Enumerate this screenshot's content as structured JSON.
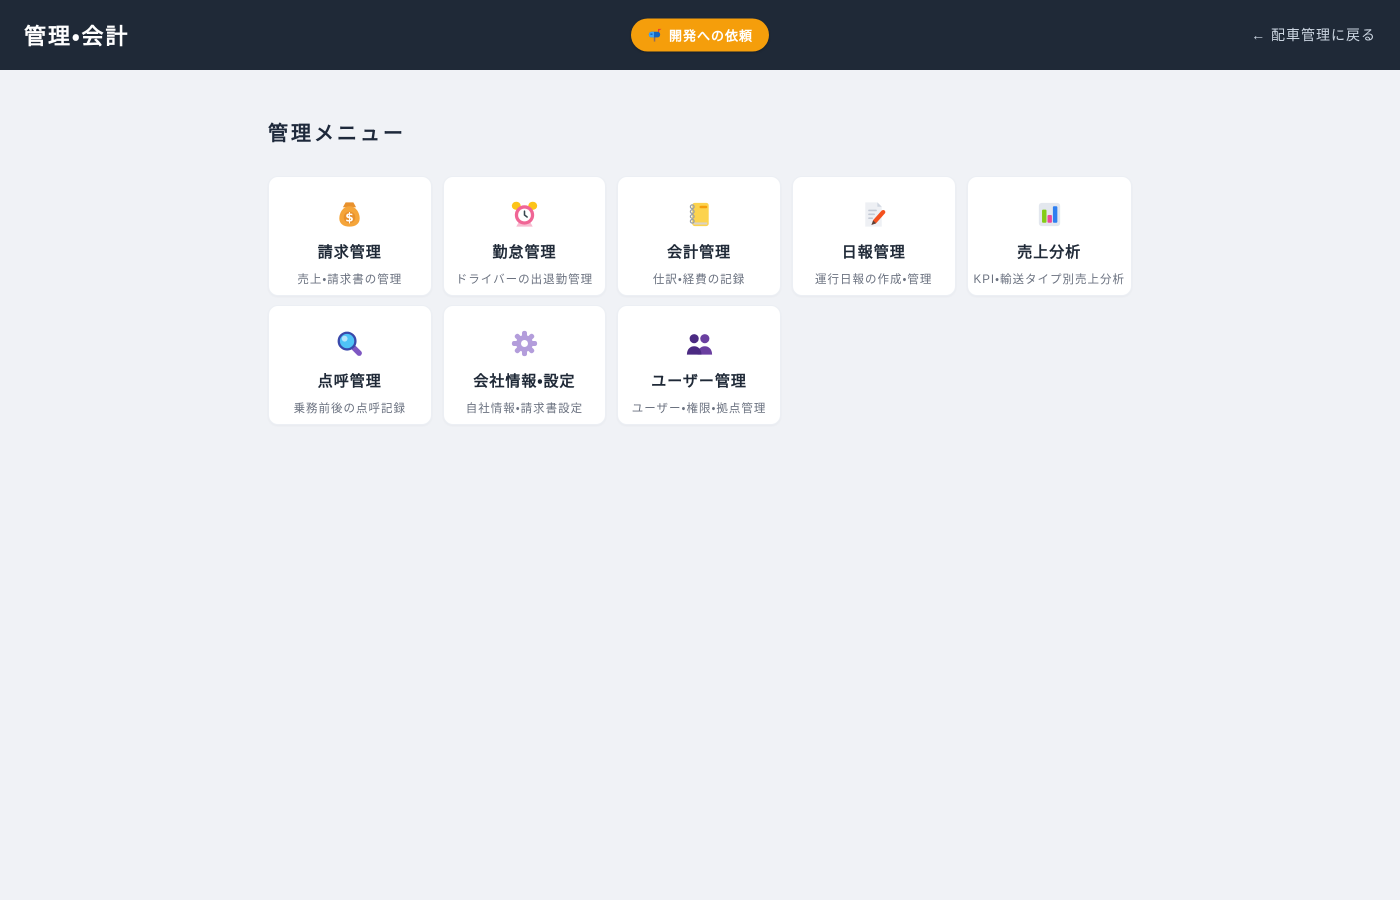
{
  "header": {
    "title": "管理・会計",
    "request_button": {
      "label": "開発への依頼",
      "icon": "mailbox-icon"
    },
    "back_link": {
      "label": "← 配車管理に戻る"
    }
  },
  "main": {
    "heading": "管理メニュー",
    "cards": [
      {
        "icon": "money-bag-icon",
        "title": "請求管理",
        "subtitle": "売上・請求書の管理"
      },
      {
        "icon": "alarm-clock-icon",
        "title": "勤怠管理",
        "subtitle": "ドライバーの出退勤管理"
      },
      {
        "icon": "ledger-icon",
        "title": "会計管理",
        "subtitle": "仕訳・経費の記録"
      },
      {
        "icon": "memo-pencil-icon",
        "title": "日報管理",
        "subtitle": "運行日報の作成・管理"
      },
      {
        "icon": "bar-chart-icon",
        "title": "売上分析",
        "subtitle": "KPI・輸送タイプ別売上分析"
      },
      {
        "icon": "magnifying-glass-icon",
        "title": "点呼管理",
        "subtitle": "乗務前後の点呼記録"
      },
      {
        "icon": "gear-icon",
        "title": "会社情報・設定",
        "subtitle": "自社情報・請求書設定"
      },
      {
        "icon": "users-icon",
        "title": "ユーザー管理",
        "subtitle": "ユーザー・権限・拠点管理"
      }
    ]
  },
  "colors": {
    "header_bg": "#1f2937",
    "accent_orange": "#f59e0b",
    "page_bg": "#f0f2f6",
    "card_bg": "#ffffff",
    "title_text": "#1f2937",
    "subtitle_text": "#6b7280",
    "back_link_text": "#cbd5e1"
  }
}
